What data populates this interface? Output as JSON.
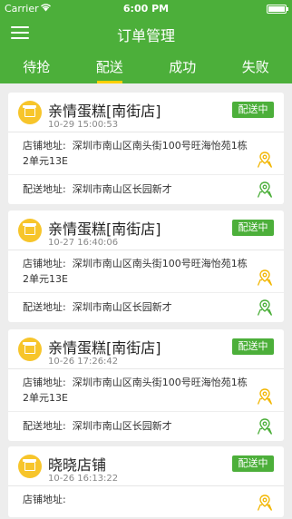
{
  "status_bar": {
    "carrier": "Carrier",
    "time": "6:00 PM"
  },
  "header": {
    "title": "订单管理"
  },
  "tabs": [
    {
      "label": "待抢",
      "active": false
    },
    {
      "label": "配送",
      "active": true
    },
    {
      "label": "成功",
      "active": false
    },
    {
      "label": "失败",
      "active": false
    }
  ],
  "orders": [
    {
      "shop_name": "亲情蛋糕[南街店]",
      "time": "10-29 15:00:53",
      "status": "配送中",
      "store_label": "店铺地址:",
      "store_address": "深圳市南山区南头街100号旺海怡苑1栋2单元13E",
      "deliver_label": "配送地址:",
      "deliver_address": "深圳市南山区长园新才"
    },
    {
      "shop_name": "亲情蛋糕[南街店]",
      "time": "10-27 16:40:06",
      "status": "配送中",
      "store_label": "店铺地址:",
      "store_address": "深圳市南山区南头街100号旺海怡苑1栋2单元13E",
      "deliver_label": "配送地址:",
      "deliver_address": "深圳市南山区长园新才"
    },
    {
      "shop_name": "亲情蛋糕[南街店]",
      "time": "10-26 17:26:42",
      "status": "配送中",
      "store_label": "店铺地址:",
      "store_address": "深圳市南山区南头街100号旺海怡苑1栋2单元13E",
      "deliver_label": "配送地址:",
      "deliver_address": "深圳市南山区长园新才"
    },
    {
      "shop_name": "晓晓店铺",
      "time": "10-26 16:13:22",
      "status": "配送中",
      "store_label": "店铺地址:",
      "store_address": ""
    }
  ],
  "colors": {
    "primary": "#4caf3a",
    "tab_indicator": "#ffd000",
    "shop_icon": "#f7c52b",
    "store_pin": "#f2b705",
    "deliver_pin": "#4caf3a"
  },
  "icons": {
    "menu": "hamburger-menu-icon",
    "shop": "shop-icon",
    "store_pin": "map-pin-icon",
    "deliver_pin": "map-pin-icon"
  }
}
